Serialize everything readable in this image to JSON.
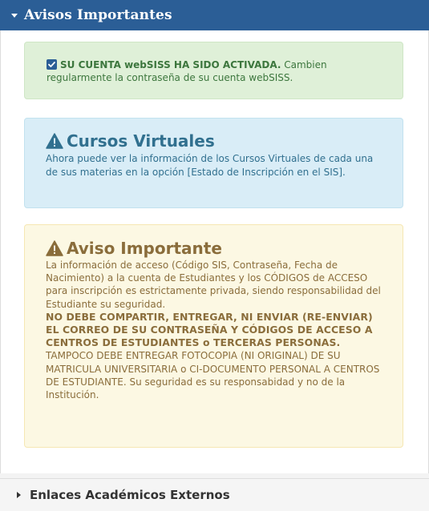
{
  "header": {
    "title": "Avisos Importantes",
    "caret_icon": "caret-down-icon"
  },
  "alerts": {
    "success": {
      "icon": "checkbox-checked-icon",
      "bold_text": "SU CUENTA webSISS HA SIDO ACTIVADA.",
      "text": " Cambien regularmente la contraseña de su cuenta webSISS."
    },
    "info": {
      "icon": "warning-triangle-icon",
      "heading": "Cursos Virtuales",
      "text": "Ahora puede ver la información de los Cursos Virtuales de cada una de sus materias en la opción [Estado de Inscripción en el SIS]."
    },
    "warning": {
      "icon": "warning-triangle-icon",
      "heading": "Aviso Importante",
      "text_intro": "La información de acceso (Código SIS, Contraseña, Fecha de Nacimiento) a la cuenta de Estudiantes y los CÓDIGOS de ACCESO para inscripción es estrictamente privada, siendo responsabilidad del Estudiante su seguridad.",
      "text_bold": "NO DEBE COMPARTIR, ENTREGAR, NI ENVIAR (RE-ENVIAR) EL CORREO DE SU CONTRASEÑA Y CÓDIGOS DE ACCESO A CENTROS DE ESTUDIANTES o TERCERAS PERSONAS.",
      "text_outro": " TAMPOCO DEBE ENTREGAR FOTOCOPIA (NI ORIGINAL) DE SU MATRICULA UNIVERSITARIA o CI-DOCUMENTO PERSONAL A CENTROS DE ESTUDIANTE. Su seguridad es su responsabidad y no de la Institución."
    }
  },
  "footer": {
    "title": "Enlaces Académicos Externos",
    "caret_icon": "caret-right-icon"
  },
  "colors": {
    "header_bg": "#2b5e96",
    "success_bg": "#dff0d8",
    "info_bg": "#d9edf7",
    "warning_bg": "#fcf8e3"
  }
}
